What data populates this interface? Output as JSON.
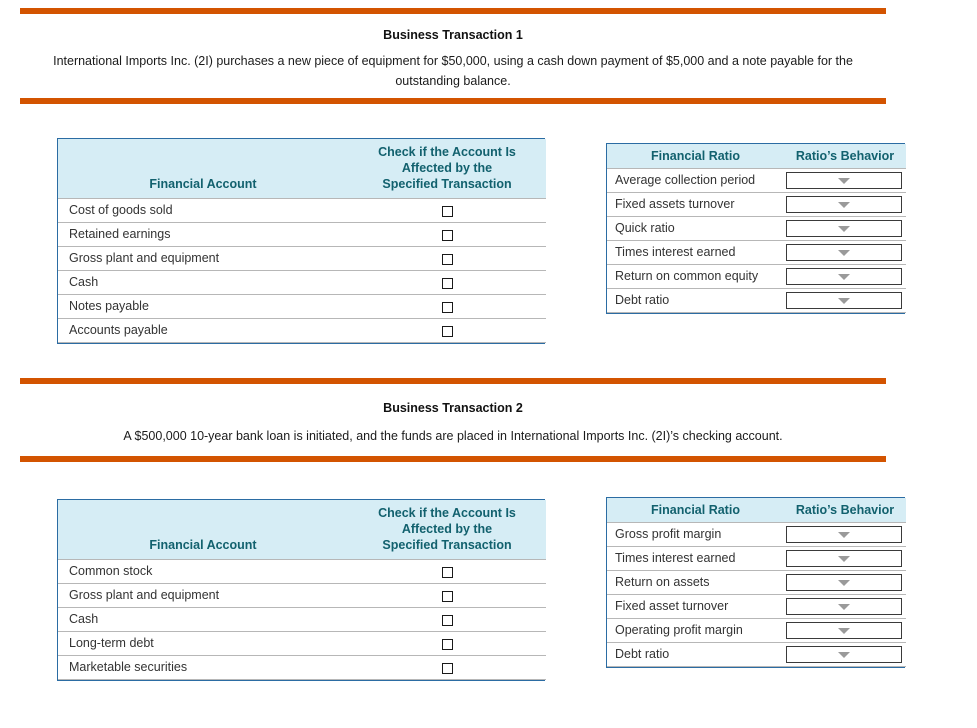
{
  "theme": {
    "rule_color": "#d35400",
    "table_border_color": "#2b6ca3",
    "header_bg": "#d6edf5",
    "header_text_color": "#12616e",
    "row_divider_color": "#b7b7b7",
    "dropdown_caret_color": "#9a9a9a"
  },
  "sections": [
    {
      "heading": "Business Transaction 1",
      "description": "International Imports Inc. (2I) purchases a new piece of equipment for $50,000, using a cash down payment of $5,000 and a note payable for the outstanding balance.",
      "accounts_table": {
        "headers": {
          "name": "Financial Account",
          "check": "Check if the Account Is Affected by the Specified Transaction",
          "check_line1": "Check if the Account Is Affected by the",
          "check_line2": "Specified Transaction"
        },
        "rows": [
          {
            "account": "Cost of goods sold",
            "checked": false
          },
          {
            "account": "Retained earnings",
            "checked": false
          },
          {
            "account": "Gross plant and equipment",
            "checked": false
          },
          {
            "account": "Cash",
            "checked": false
          },
          {
            "account": "Notes payable",
            "checked": false
          },
          {
            "account": "Accounts payable",
            "checked": false
          }
        ]
      },
      "ratios_table": {
        "headers": {
          "ratio": "Financial Ratio",
          "behavior": "Ratio’s Behavior"
        },
        "rows": [
          {
            "ratio": "Average collection period",
            "behavior": ""
          },
          {
            "ratio": "Fixed assets turnover",
            "behavior": ""
          },
          {
            "ratio": "Quick ratio",
            "behavior": ""
          },
          {
            "ratio": "Times interest earned",
            "behavior": ""
          },
          {
            "ratio": "Return on common equity",
            "behavior": ""
          },
          {
            "ratio": "Debt ratio",
            "behavior": ""
          }
        ]
      }
    },
    {
      "heading": "Business Transaction 2",
      "description": "A $500,000 10-year bank loan is initiated, and the funds are placed in International Imports Inc. (2I)’s checking account.",
      "accounts_table": {
        "headers": {
          "name": "Financial Account",
          "check": "Check if the Account Is Affected by the Specified Transaction",
          "check_line1": "Check if the Account Is Affected by the",
          "check_line2": "Specified Transaction"
        },
        "rows": [
          {
            "account": "Common stock",
            "checked": false
          },
          {
            "account": "Gross plant and equipment",
            "checked": false
          },
          {
            "account": "Cash",
            "checked": false
          },
          {
            "account": "Long-term debt",
            "checked": false
          },
          {
            "account": "Marketable securities",
            "checked": false
          }
        ]
      },
      "ratios_table": {
        "headers": {
          "ratio": "Financial Ratio",
          "behavior": "Ratio’s Behavior"
        },
        "rows": [
          {
            "ratio": "Gross profit margin",
            "behavior": ""
          },
          {
            "ratio": "Times interest earned",
            "behavior": ""
          },
          {
            "ratio": "Return on assets",
            "behavior": ""
          },
          {
            "ratio": "Fixed asset turnover",
            "behavior": ""
          },
          {
            "ratio": "Operating profit margin",
            "behavior": ""
          },
          {
            "ratio": "Debt ratio",
            "behavior": ""
          }
        ]
      }
    }
  ]
}
